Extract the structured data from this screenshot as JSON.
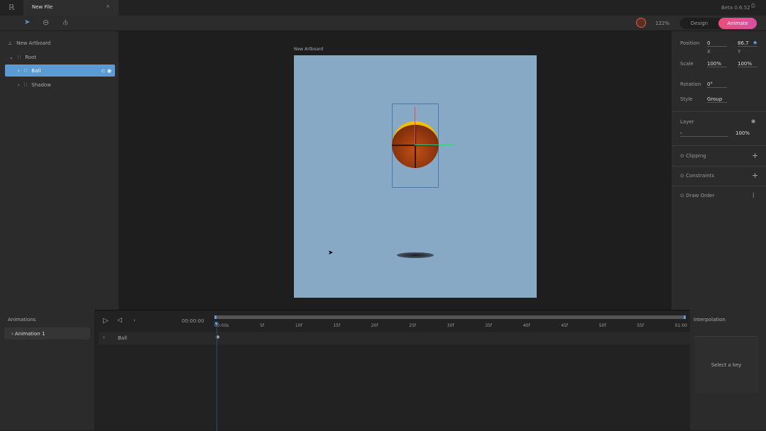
{
  "app": {
    "tab_title": "New File",
    "version": "Beta 0.6.52",
    "zoom": "122%"
  },
  "modes": {
    "design": "Design",
    "animate": "Animate"
  },
  "hierarchy": {
    "artboard": "New Artboard",
    "items": [
      {
        "label": "Root"
      },
      {
        "label": "Ball"
      },
      {
        "label": "Shadow"
      }
    ]
  },
  "canvas": {
    "artboard_label": "New Artboard"
  },
  "inspector": {
    "position_label": "Position",
    "pos_x": "0",
    "pos_y": "86.7",
    "x": "X",
    "y": "Y",
    "scale_label": "Scale",
    "scale_x": "100%",
    "scale_y": "100%",
    "rotation_label": "Rotation",
    "rotation": "0°",
    "style_label": "Style",
    "style": "Group",
    "layer_label": "Layer",
    "layer_blend": "-",
    "opacity": "100%",
    "clipping": "Clipping",
    "constraints": "Constraints",
    "draw_order": "Draw Order"
  },
  "animations": {
    "title": "Animations",
    "items": [
      "Animation 1"
    ],
    "time": "00:00:00"
  },
  "timeline": {
    "ticks": [
      "00:00s",
      "5f",
      "10f",
      "15f",
      "20f",
      "25f",
      "30f",
      "35f",
      "40f",
      "45f",
      "50f",
      "55f",
      "01:00"
    ],
    "tracks": [
      "Ball"
    ]
  },
  "interpolation": {
    "title": "Interpolation",
    "empty": "Select a key"
  },
  "colors": {
    "accent": "#5b9bd5",
    "animate": "#e8508f",
    "artboard": "#87a9c6"
  }
}
